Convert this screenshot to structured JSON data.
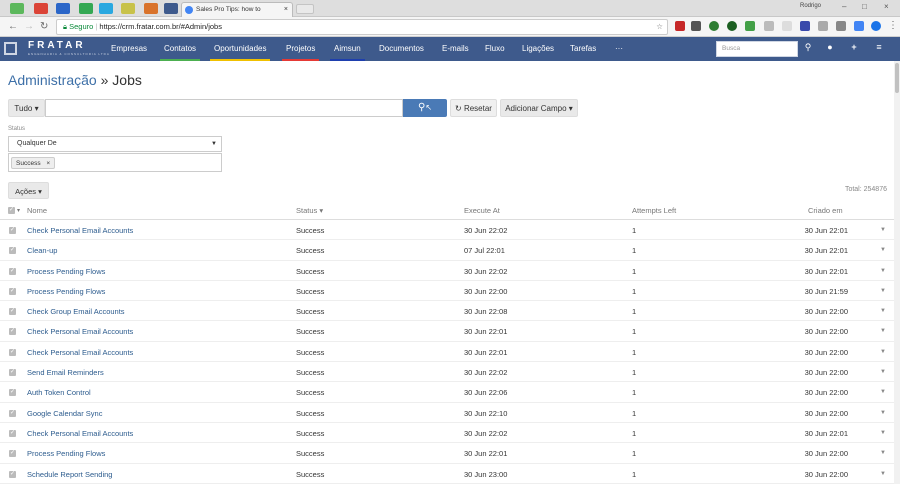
{
  "browser": {
    "active_tab_title": "Sales Pro Tips: how to",
    "user": "Rodrigo",
    "address": {
      "secure_label": "Seguro",
      "url": "https://crm.fratar.com.br/#Admin/jobs"
    }
  },
  "app": {
    "logo": "FRATAR",
    "logo_sub": "ENGENHARIA & CONSULTORIA LTDA",
    "menu": [
      {
        "label": "Empresas",
        "color": "#3e5a8c"
      },
      {
        "label": "Contatos",
        "color": "#4caf50"
      },
      {
        "label": "Oportunidades",
        "color": "#f0c000"
      },
      {
        "label": "Projetos",
        "color": "#e53935"
      },
      {
        "label": "Aimsun",
        "color": "#1e3fae"
      },
      {
        "label": "Documentos",
        "color": "#3e5a8c"
      },
      {
        "label": "E-mails",
        "color": "#3e5a8c"
      },
      {
        "label": "Fluxo",
        "color": "#3e5a8c"
      },
      {
        "label": "Ligações",
        "color": "#3e5a8c"
      },
      {
        "label": "Tarefas",
        "color": "#3e5a8c"
      },
      {
        "label": "···",
        "color": "#3e5a8c"
      }
    ],
    "search_placeholder": "Busca"
  },
  "page": {
    "breadcrumb_link": "Administração",
    "breadcrumb_sep": " » ",
    "title": "Jobs",
    "filter_scope": "Tudo",
    "reset_label": "Resetar",
    "add_field_label": "Adicionar Campo",
    "status_label": "Status",
    "status_select": "Qualquer De",
    "status_tag": "Success",
    "actions_label": "Ações",
    "total": "Total: 254876"
  },
  "table": {
    "headers": {
      "name": "Nome",
      "status": "Status",
      "execute_at": "Execute At",
      "attempts": "Attempts Left",
      "created": "Criado em"
    },
    "rows": [
      {
        "name": "Check Personal Email Accounts",
        "status": "Success",
        "execute_at": "30 Jun 22:02",
        "attempts": "1",
        "created": "30 Jun 22:01"
      },
      {
        "name": "Clean-up",
        "status": "Success",
        "execute_at": "07 Jul 22:01",
        "attempts": "1",
        "created": "30 Jun 22:01"
      },
      {
        "name": "Process Pending Flows",
        "status": "Success",
        "execute_at": "30 Jun 22:02",
        "attempts": "1",
        "created": "30 Jun 22:01"
      },
      {
        "name": "Process Pending Flows",
        "status": "Success",
        "execute_at": "30 Jun 22:00",
        "attempts": "1",
        "created": "30 Jun 21:59"
      },
      {
        "name": "Check Group Email Accounts",
        "status": "Success",
        "execute_at": "30 Jun 22:08",
        "attempts": "1",
        "created": "30 Jun 22:00"
      },
      {
        "name": "Check Personal Email Accounts",
        "status": "Success",
        "execute_at": "30 Jun 22:01",
        "attempts": "1",
        "created": "30 Jun 22:00"
      },
      {
        "name": "Check Personal Email Accounts",
        "status": "Success",
        "execute_at": "30 Jun 22:01",
        "attempts": "1",
        "created": "30 Jun 22:00"
      },
      {
        "name": "Send Email Reminders",
        "status": "Success",
        "execute_at": "30 Jun 22:02",
        "attempts": "1",
        "created": "30 Jun 22:00"
      },
      {
        "name": "Auth Token Control",
        "status": "Success",
        "execute_at": "30 Jun 22:06",
        "attempts": "1",
        "created": "30 Jun 22:00"
      },
      {
        "name": "Google Calendar Sync",
        "status": "Success",
        "execute_at": "30 Jun 22:10",
        "attempts": "1",
        "created": "30 Jun 22:00"
      },
      {
        "name": "Check Personal Email Accounts",
        "status": "Success",
        "execute_at": "30 Jun 22:02",
        "attempts": "1",
        "created": "30 Jun 22:01"
      },
      {
        "name": "Process Pending Flows",
        "status": "Success",
        "execute_at": "30 Jun 22:01",
        "attempts": "1",
        "created": "30 Jun 22:00"
      },
      {
        "name": "Schedule Report Sending",
        "status": "Success",
        "execute_at": "30 Jun 23:00",
        "attempts": "1",
        "created": "30 Jun 22:00"
      }
    ]
  },
  "colors": {
    "nav_bg": "#3e5a8c",
    "link": "#2d5c8e",
    "primary_btn": "#4a7ab6"
  }
}
